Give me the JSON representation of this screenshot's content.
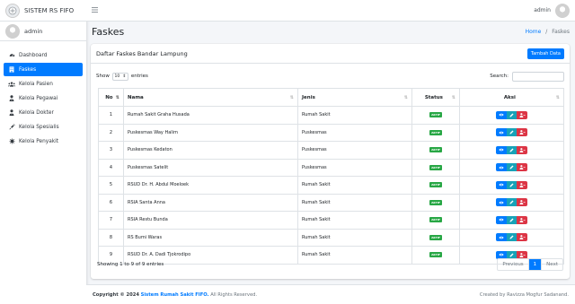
{
  "brand": {
    "title": "SISTEM RS FIFO"
  },
  "user": {
    "name": "admin"
  },
  "sidebar": {
    "items": [
      {
        "label": "Dashboard",
        "icon": "dashboard-icon",
        "active": false
      },
      {
        "label": "Faskes",
        "icon": "building-icon",
        "active": true
      },
      {
        "label": "Kelola Pasien",
        "icon": "users-icon",
        "active": false
      },
      {
        "label": "Kelola Pegawai",
        "icon": "user-tie-icon",
        "active": false
      },
      {
        "label": "Kelola Dokter",
        "icon": "user-md-icon",
        "active": false
      },
      {
        "label": "Kelola Spesialis",
        "icon": "syringe-icon",
        "active": false
      },
      {
        "label": "Kelola Penyakit",
        "icon": "virus-icon",
        "active": false
      }
    ]
  },
  "topbar": {
    "user": "admin"
  },
  "header": {
    "title": "Faskes",
    "breadcrumb_home": "Home",
    "breadcrumb_sep": "/",
    "breadcrumb_current": "Faskes"
  },
  "card": {
    "title": "Daftar Faskes Bandar Lampung",
    "add_button": "Tambah Data",
    "show_label": "Show",
    "entries_value": "10",
    "entries_label": "entries",
    "search_label": "Search:",
    "search_placeholder": ""
  },
  "table": {
    "columns": [
      "No",
      "Nama",
      "Jenis",
      "Status",
      "Aksi"
    ],
    "rows": [
      {
        "no": "1",
        "nama": "Rumah Sakit Graha Husada",
        "jenis": "Rumah Sakit",
        "status": "AKTIF"
      },
      {
        "no": "2",
        "nama": "Puskesmas Way Halim",
        "jenis": "Puskesmas",
        "status": "AKTIF"
      },
      {
        "no": "3",
        "nama": "Puskesmas Kedaton",
        "jenis": "Puskesmas",
        "status": "AKTIF"
      },
      {
        "no": "4",
        "nama": "Puskesmas Satelit",
        "jenis": "Puskesmas",
        "status": "AKTIF"
      },
      {
        "no": "5",
        "nama": "RSUD Dr. H. Abdul Moeloek",
        "jenis": "Rumah Sakit",
        "status": "AKTIF"
      },
      {
        "no": "6",
        "nama": "RSIA Santa Anna",
        "jenis": "Rumah Sakit",
        "status": "AKTIF"
      },
      {
        "no": "7",
        "nama": "RSIA Restu Bunda",
        "jenis": "Rumah Sakit",
        "status": "AKTIF"
      },
      {
        "no": "8",
        "nama": "RS Bumi Waras",
        "jenis": "Rumah Sakit",
        "status": "AKTIF"
      },
      {
        "no": "9",
        "nama": "RSUD Dr. A. Dadi Tjokrodipo",
        "jenis": "Rumah Sakit",
        "status": "AKTIF"
      }
    ]
  },
  "pagination": {
    "info": "Showing 1 to 9 of 9 entries",
    "previous": "Previous",
    "page": "1",
    "next": "Next"
  },
  "footer": {
    "copyright_prefix": "Copyright © 2024",
    "copyright_link": "Sistem Rumah Sakit FIFO.",
    "copyright_suffix": "All Rights Reserved.",
    "credit": "Created by Ravizza Mogfur Sadanand."
  },
  "colors": {
    "primary": "#007bff",
    "info": "#17a2b8",
    "danger": "#dc3545",
    "success": "#28a745"
  }
}
